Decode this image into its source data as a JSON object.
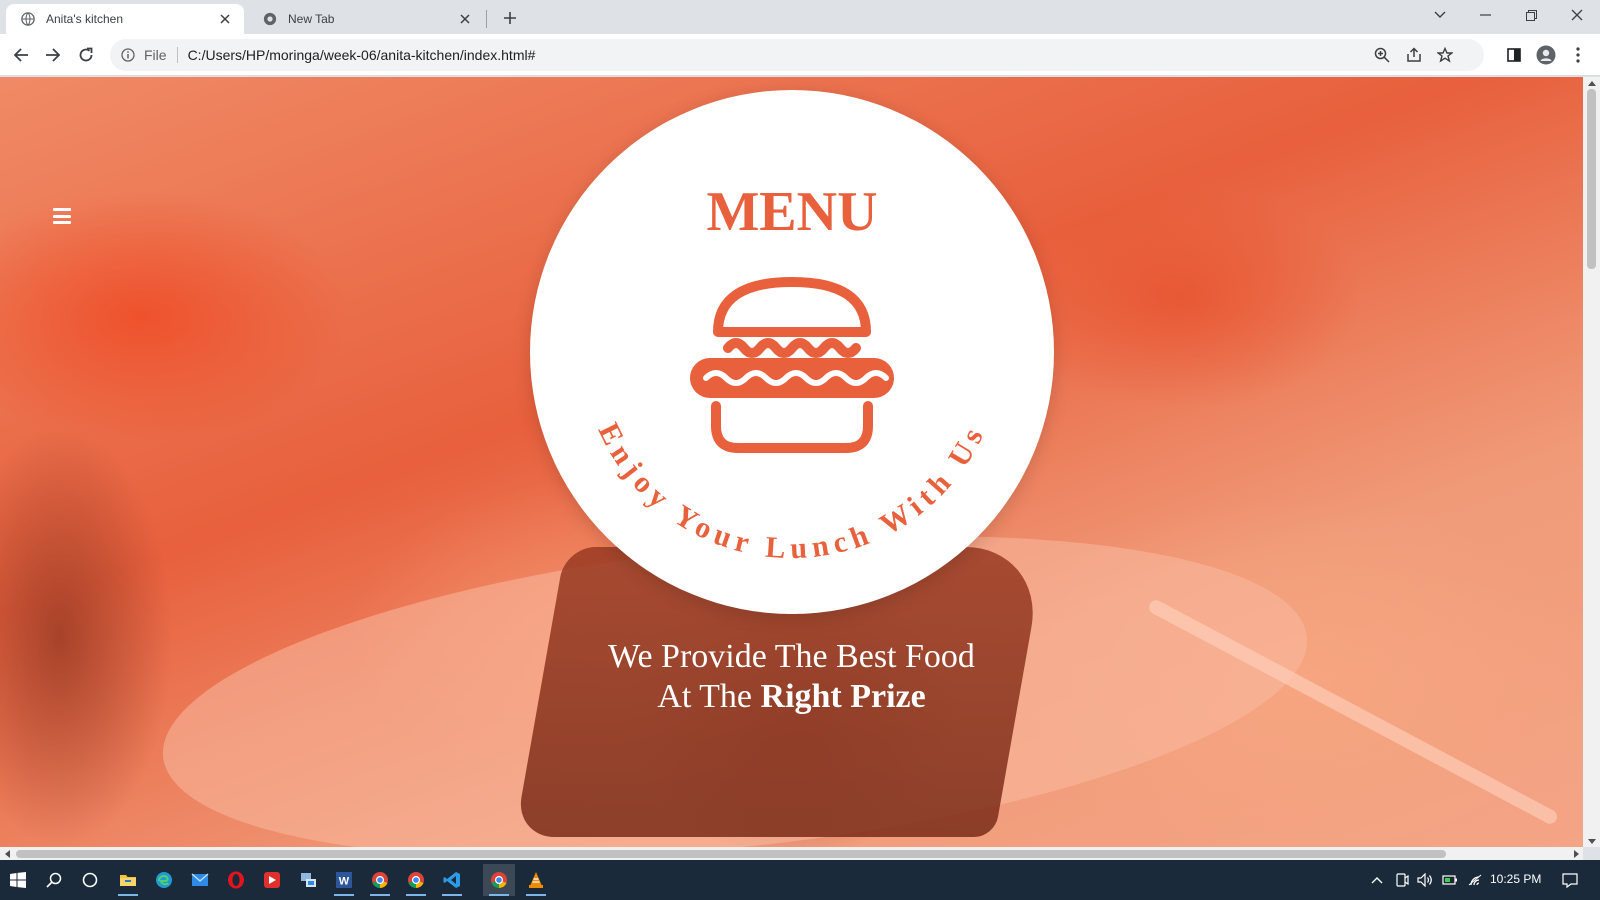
{
  "browser": {
    "tabs": [
      {
        "title": "Anita's kitchen",
        "active": true,
        "icon": "globe-icon"
      },
      {
        "title": "New Tab",
        "active": false,
        "icon": "chrome-icon"
      }
    ],
    "address": {
      "scheme_label": "File",
      "url": "C:/Users/HP/moringa/week-06/anita-kitchen/index.html#"
    }
  },
  "page": {
    "menu_icon": "hamburger-menu-icon",
    "logo": {
      "title": "MENU",
      "arc_text": "Enjoy Your Lunch With Us",
      "icon": "burger-icon",
      "color": "#e8603c"
    },
    "tagline": {
      "line1": "We Provide The Best Food",
      "line2_prefix": "At The",
      "line2_bold": "Right Prize"
    }
  },
  "taskbar": {
    "time": "10:25 PM",
    "apps": [
      "start-icon",
      "search-icon",
      "cortana-icon",
      "file-explorer-icon",
      "edge-icon",
      "mail-icon",
      "opera-icon",
      "media-icon",
      "network-app-icon",
      "word-icon",
      "chrome-icon",
      "chrome-icon",
      "vscode-icon",
      "chrome-icon",
      "vlc-icon"
    ]
  },
  "colors": {
    "accent": "#e8603c",
    "taskbar": "#1b2a3a"
  }
}
